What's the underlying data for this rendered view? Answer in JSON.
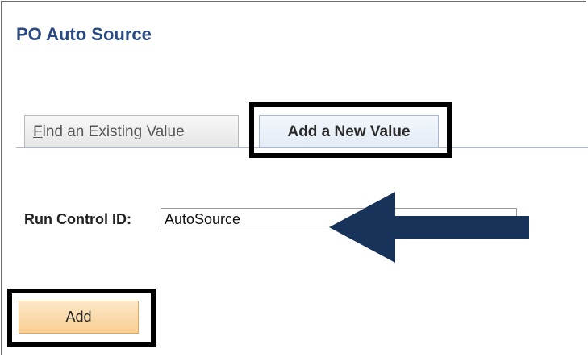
{
  "page": {
    "title": "PO Auto Source"
  },
  "tabs": [
    {
      "accesskey_char": "F",
      "rest_label": "ind an Existing Value",
      "selected": false
    },
    {
      "label": "Add a New Value",
      "selected": true
    }
  ],
  "form": {
    "run_control_label": "Run Control ID:",
    "run_control_value": "AutoSource"
  },
  "actions": {
    "add_label": "Add"
  },
  "annotations": {
    "highlight_color": "#000000",
    "arrow_color": "#17335a"
  },
  "colors": {
    "title": "#2a4a82",
    "add_button": "#f9cf93"
  }
}
